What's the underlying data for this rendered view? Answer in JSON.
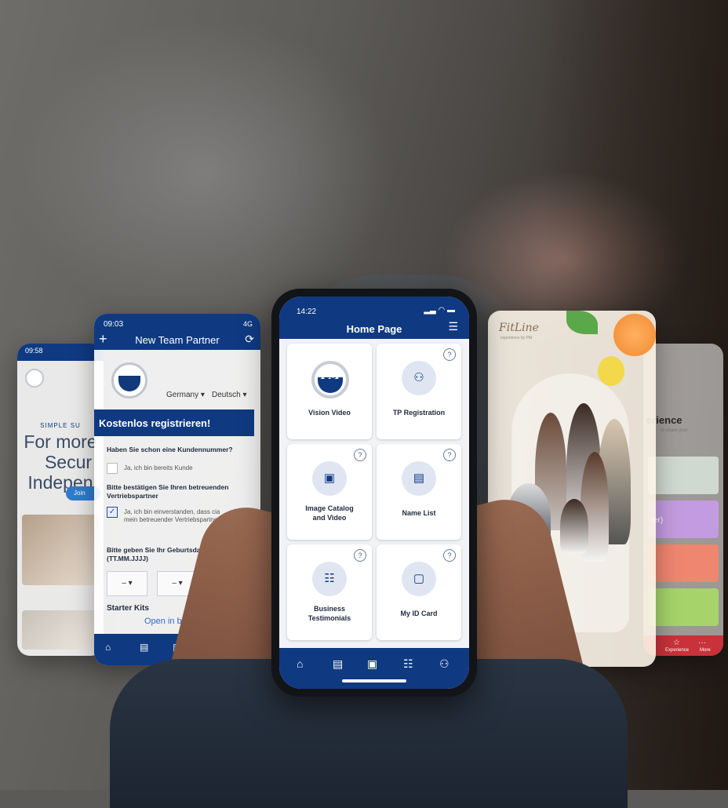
{
  "colors": {
    "brand_blue": "#0f3a82",
    "accent_blue": "#2e6ad0",
    "fitline_red": "#c8323a"
  },
  "main_phone": {
    "time": "14:22",
    "status_icons": "signal wifi battery",
    "title": "Home Page",
    "filter_icon": "sliders-icon",
    "tiles": [
      {
        "label": "Vision Video",
        "icon": "pm-logo",
        "help": false
      },
      {
        "label": "TP Registration",
        "icon": "partner-icon",
        "help": true
      },
      {
        "label": "Image Catalog\nand Video",
        "icon": "briefcase-icon",
        "help": true
      },
      {
        "label": "Name List",
        "icon": "list-icon",
        "help": true
      },
      {
        "label": "Business\nTestimonials",
        "icon": "chat-icon",
        "help": true
      },
      {
        "label": "My ID Card",
        "icon": "id-card-icon",
        "help": true
      }
    ],
    "help_symbol": "?",
    "nav_icons": [
      "home-icon",
      "list-icon",
      "briefcase-icon",
      "chat-icon",
      "partner-icon"
    ]
  },
  "left_card_back": {
    "time": "09:58",
    "slogan": "SIMPLE SU",
    "headline": [
      "For more",
      "Secur",
      "Indepen"
    ],
    "button": "Join"
  },
  "left_card_front": {
    "time": "09:03",
    "status": "4G",
    "title": "New Team Partner",
    "country": "Germany",
    "language": "Deutsch",
    "banner": "Kostenlos registrieren!",
    "q1": "Haben Sie schon eine Kundennummer?",
    "q1_option": "Ja, ich bin bereits Kunde",
    "q2": "Bitte bestätigen Sie Ihren betreuenden Vertriebspartner",
    "q2_option": "Ja, ich bin einverstanden, dass   cia mein betreuender Vertriebspartner ist.",
    "q3": "Bitte geben Sie Ihr Geburtsdatum ein (TT.MM.JJJJ)",
    "date_placeholder": "–",
    "section": "Starter Kits",
    "open_browser": "Open in bro"
  },
  "right_card_front": {
    "brand": "FitLine",
    "tagline": "experience by PM"
  },
  "right_card_back": {
    "headline": "erience",
    "sub": "to share your",
    "banner": "ver)",
    "nav_labels": [
      "Experience",
      "More"
    ]
  }
}
